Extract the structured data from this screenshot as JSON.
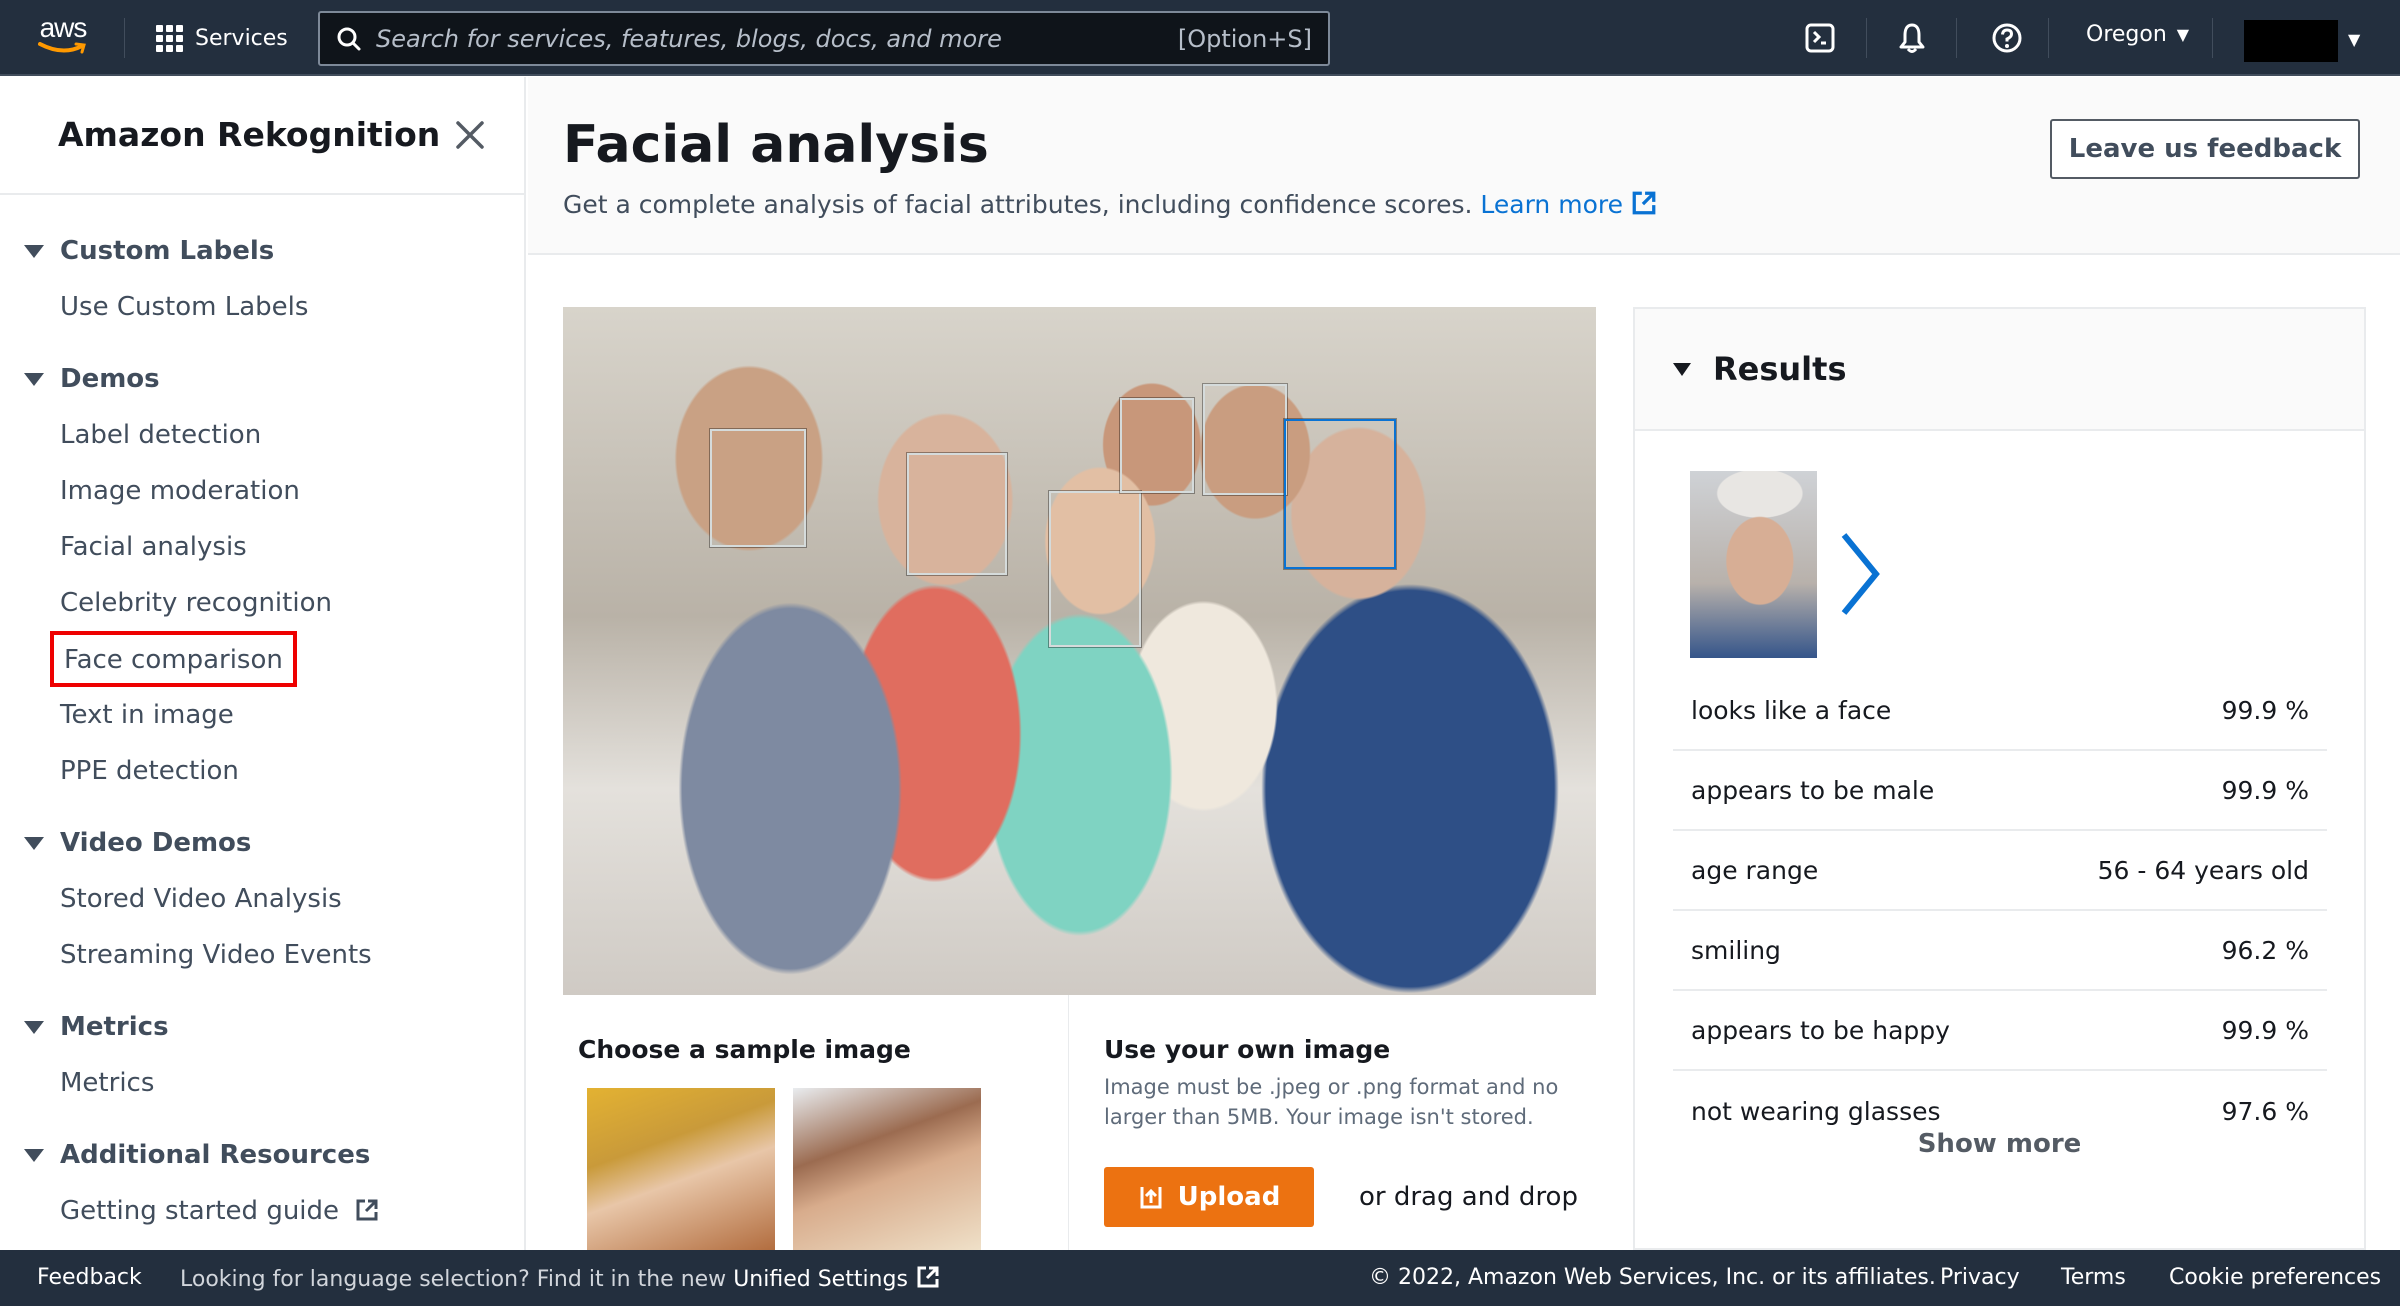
{
  "topnav": {
    "logo_text": "aws",
    "services_label": "Services",
    "search_placeholder": "Search for services, features, blogs, docs, and more",
    "search_shortcut": "[Option+S]",
    "icons": [
      "cloudshell-icon",
      "bell-icon",
      "help-icon"
    ],
    "region": "Oregon"
  },
  "sidebar": {
    "title": "Amazon Rekognition",
    "sections": [
      {
        "label": "Custom Labels",
        "items": [
          "Use Custom Labels"
        ]
      },
      {
        "label": "Demos",
        "items": [
          "Label detection",
          "Image moderation",
          "Facial analysis",
          "Celebrity recognition",
          "Face comparison",
          "Text in image",
          "PPE detection"
        ]
      },
      {
        "label": "Video Demos",
        "items": [
          "Stored Video Analysis",
          "Streaming Video Events"
        ]
      },
      {
        "label": "Metrics",
        "items": [
          "Metrics"
        ]
      },
      {
        "label": "Additional Resources",
        "items": [
          "Getting started guide"
        ]
      }
    ],
    "highlighted_item": "Face comparison",
    "highlight_color": "#e00000"
  },
  "header": {
    "title": "Facial analysis",
    "description": "Get a complete analysis of facial attributes, including confidence scores.",
    "learn_more": "Learn more",
    "feedback_button": "Leave us feedback"
  },
  "sample": {
    "title": "Choose a sample image",
    "thumbnails": [
      "woman-sunglasses-car",
      "family-three-people"
    ]
  },
  "own_image": {
    "title": "Use your own image",
    "description": "Image must be .jpeg or .png format and no larger than 5MB. Your image isn't stored.",
    "upload_label": "Upload",
    "drag_text": "or drag and drop",
    "accent_color": "#ec7211"
  },
  "detected_faces": {
    "count": 6,
    "selected_index": 5
  },
  "results": {
    "title": "Results",
    "attributes": [
      {
        "label": "looks like a face",
        "value": "99.9 %"
      },
      {
        "label": "appears to be male",
        "value": "99.9 %"
      },
      {
        "label": "age range",
        "value": "56 - 64 years old"
      },
      {
        "label": "smiling",
        "value": "96.2 %"
      },
      {
        "label": "appears to be happy",
        "value": "99.9 %"
      },
      {
        "label": "not wearing glasses",
        "value": "97.6 %"
      }
    ],
    "show_more": "Show more"
  },
  "footer": {
    "feedback": "Feedback",
    "language_text": "Looking for language selection? Find it in the new",
    "unified_settings": "Unified Settings",
    "copyright": "© 2022, Amazon Web Services, Inc. or its affiliates.",
    "privacy": "Privacy",
    "terms": "Terms",
    "cookies": "Cookie preferences"
  }
}
